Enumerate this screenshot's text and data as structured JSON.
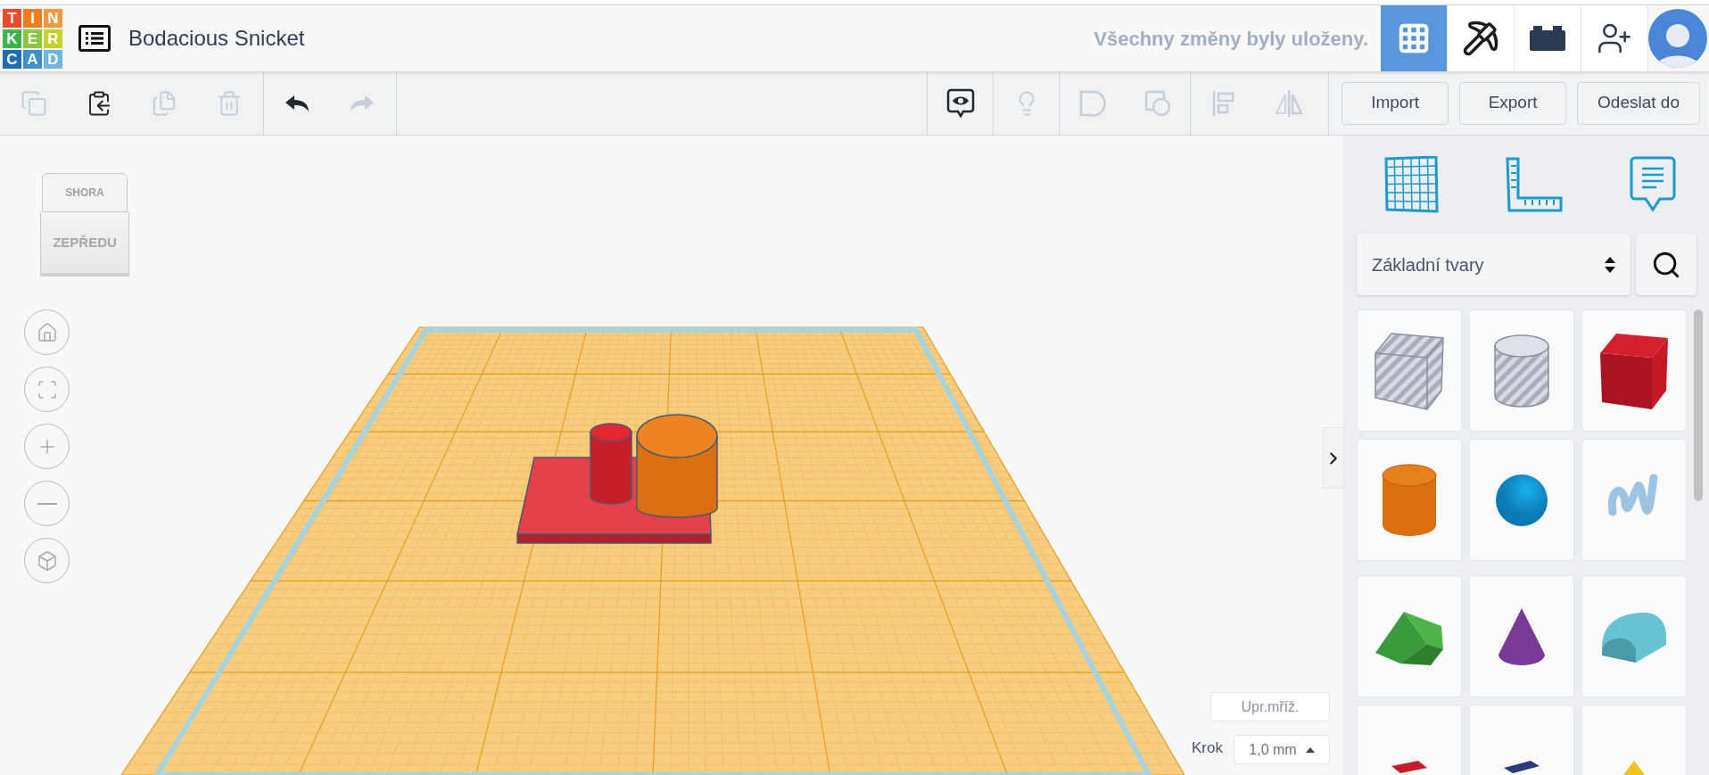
{
  "header": {
    "logo_letters": [
      "T",
      "I",
      "N",
      "K",
      "E",
      "R",
      "C",
      "A",
      "D"
    ],
    "title": "Bodacious Snicket",
    "save_status": "Všechny změny byly uloženy.",
    "view_modes": [
      {
        "kind": "grid",
        "selected": true
      },
      {
        "kind": "pickaxe",
        "selected": false
      },
      {
        "kind": "bricks",
        "selected": false
      }
    ]
  },
  "toolbar": {
    "tools": [
      {
        "kind": "copy",
        "disabled": true
      },
      {
        "kind": "paste",
        "disabled": false
      },
      {
        "kind": "duplicate",
        "disabled": true
      },
      {
        "kind": "delete",
        "disabled": true
      },
      {
        "kind": "undo",
        "disabled": false
      },
      {
        "kind": "redo",
        "disabled": true
      },
      {
        "kind": "notes",
        "disabled": false
      },
      {
        "kind": "bulb",
        "disabled": true
      },
      {
        "kind": "solid",
        "disabled": true
      },
      {
        "kind": "hole",
        "disabled": true
      },
      {
        "kind": "align",
        "disabled": true
      },
      {
        "kind": "mirror",
        "disabled": true
      }
    ],
    "buttons": [
      "Import",
      "Export",
      "Odeslat do"
    ]
  },
  "view_cube": {
    "top": "SHORA",
    "front": "ZEPŘEDU"
  },
  "grid_controls": {
    "edit_grid": "Upr.mříž.",
    "step_label": "Krok",
    "step_value": "1,0 mm"
  },
  "panel": {
    "category": "Základní tvary",
    "shapes": [
      {
        "kind": "box-hole"
      },
      {
        "kind": "cylinder-hole"
      },
      {
        "kind": "box"
      },
      {
        "kind": "cylinder"
      },
      {
        "kind": "sphere"
      },
      {
        "kind": "scribble"
      },
      {
        "kind": "roof"
      },
      {
        "kind": "cone"
      },
      {
        "kind": "round-roof"
      },
      {
        "kind": "red-shape"
      },
      {
        "kind": "navy-shape"
      },
      {
        "kind": "pyramid"
      }
    ]
  }
}
